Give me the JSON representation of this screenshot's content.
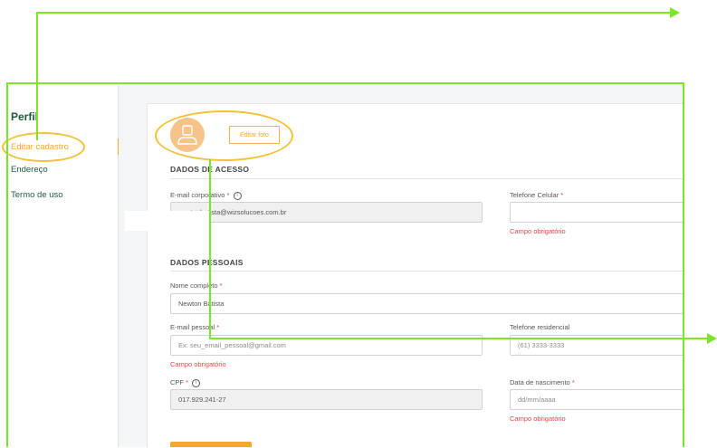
{
  "sidebar": {
    "title": "Perfil",
    "items": [
      {
        "label": "Editar cadastro",
        "active": true
      },
      {
        "label": "Endereço",
        "active": false
      },
      {
        "label": "Termo de uso",
        "active": false
      }
    ]
  },
  "profile": {
    "edit_photo_label": "Editar foto"
  },
  "access_section": {
    "title": "DADOS DE ACESSO",
    "corporate_email": {
      "label": "E-mail corporativo",
      "value": "newtonbatista@wizsolucoes.com.br"
    },
    "cell_phone": {
      "label": "Telefone Celular",
      "value": "",
      "error": "Campo obrigatório"
    }
  },
  "personal_section": {
    "title": "DADOS PESSOAIS",
    "full_name": {
      "label": "Nome completo",
      "value": "Newton Batista"
    },
    "personal_email": {
      "label": "E-mail pessoal",
      "placeholder": "Ex: seu_email_pessoal@gmail.com",
      "error": "Campo obrigatório"
    },
    "home_phone": {
      "label": "Telefone residencial",
      "placeholder": "(61) 3333-3333"
    },
    "cpf": {
      "label": "CPF",
      "value": "017.929.241-27"
    },
    "birth_date": {
      "label": "Data de nascimento",
      "placeholder": "dd/mm/aaaa",
      "error": "Campo obrigatório"
    }
  },
  "required_mark": "*",
  "colors": {
    "accent": "#f0a830",
    "sidebar_text": "#1e5b3d",
    "error": "#e64545",
    "annotation": "#7ee42a",
    "highlight": "#f3c13a"
  }
}
